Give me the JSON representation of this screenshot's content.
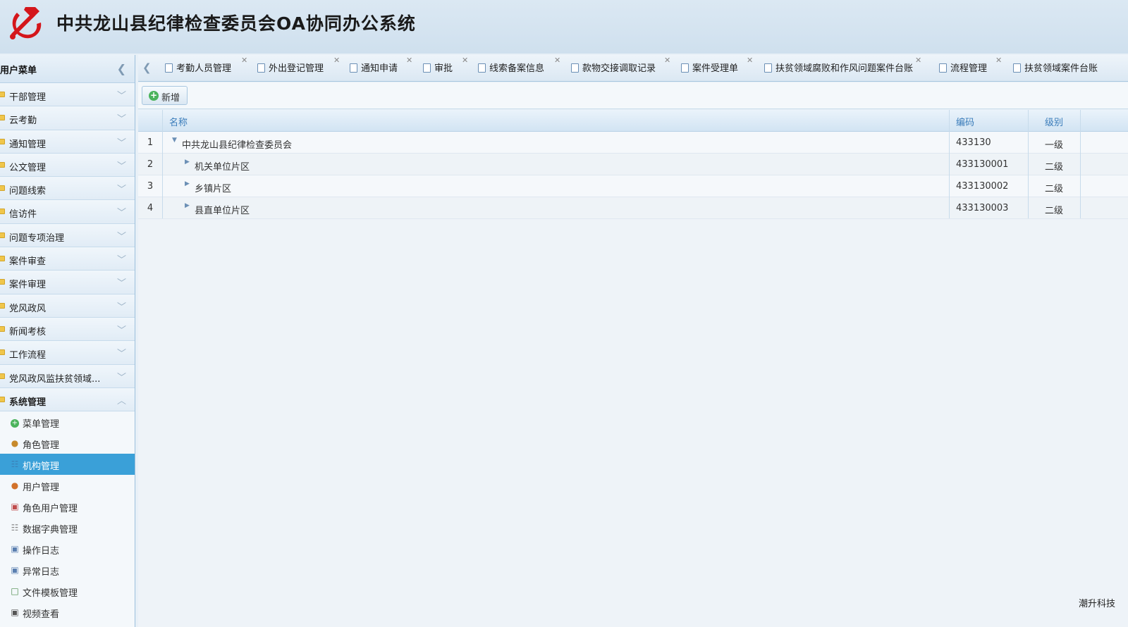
{
  "header": {
    "title": "中共龙山县纪律检查委员会OA协同办公系统",
    "emblem_icon": "hammer-sickle-emblem",
    "emblem_color": "#d4161b"
  },
  "sidebar": {
    "title": "用户菜单",
    "groups": [
      {
        "label": "干部管理"
      },
      {
        "label": "云考勤"
      },
      {
        "label": "通知管理"
      },
      {
        "label": "公文管理"
      },
      {
        "label": "问题线索"
      },
      {
        "label": "信访件"
      },
      {
        "label": "问题专项治理"
      },
      {
        "label": "案件审查"
      },
      {
        "label": "案件审理"
      },
      {
        "label": "党风政风"
      },
      {
        "label": "新闻考核"
      },
      {
        "label": "工作流程"
      },
      {
        "label": "党风政风监扶贫领域..."
      },
      {
        "label": "系统管理"
      }
    ],
    "sub_items": [
      {
        "label": "菜单管理",
        "icon": "add-circle-icon"
      },
      {
        "label": "角色管理",
        "icon": "roles-icon"
      },
      {
        "label": "机构管理",
        "icon": "org-icon"
      },
      {
        "label": "用户管理",
        "icon": "user-icon"
      },
      {
        "label": "角色用户管理",
        "icon": "role-user-icon"
      },
      {
        "label": "数据字典管理",
        "icon": "dictionary-icon"
      },
      {
        "label": "操作日志",
        "icon": "log-icon"
      },
      {
        "label": "异常日志",
        "icon": "error-log-icon"
      },
      {
        "label": "文件模板管理",
        "icon": "template-icon"
      },
      {
        "label": "视频查看",
        "icon": "camera-icon"
      }
    ],
    "active_item": "机构管理",
    "accent": "#3aa0d8"
  },
  "tabs": [
    {
      "label": "考勤人员管理"
    },
    {
      "label": "外出登记管理"
    },
    {
      "label": "通知申请"
    },
    {
      "label": "审批"
    },
    {
      "label": "线索备案信息"
    },
    {
      "label": "款物交接调取记录"
    },
    {
      "label": "案件受理单"
    },
    {
      "label": "扶贫领域腐败和作风问题案件台账"
    },
    {
      "label": "流程管理"
    },
    {
      "label": "扶贫领域案件台账"
    }
  ],
  "toolbar": {
    "add_label": "新增"
  },
  "grid": {
    "columns": {
      "name": "名称",
      "code": "编码",
      "level": "级别"
    },
    "rows": [
      {
        "no": "1",
        "name": "中共龙山县纪律检查委员会",
        "code": "433130",
        "level": "一级",
        "expanded": true
      },
      {
        "no": "2",
        "name": "机关单位片区",
        "code": "433130001",
        "level": "二级",
        "expanded": false
      },
      {
        "no": "3",
        "name": "乡镇片区",
        "code": "433130002",
        "level": "二级",
        "expanded": false
      },
      {
        "no": "4",
        "name": "县直单位片区",
        "code": "433130003",
        "level": "二级",
        "expanded": false
      }
    ]
  },
  "footer": {
    "brand": "潮升科技"
  }
}
